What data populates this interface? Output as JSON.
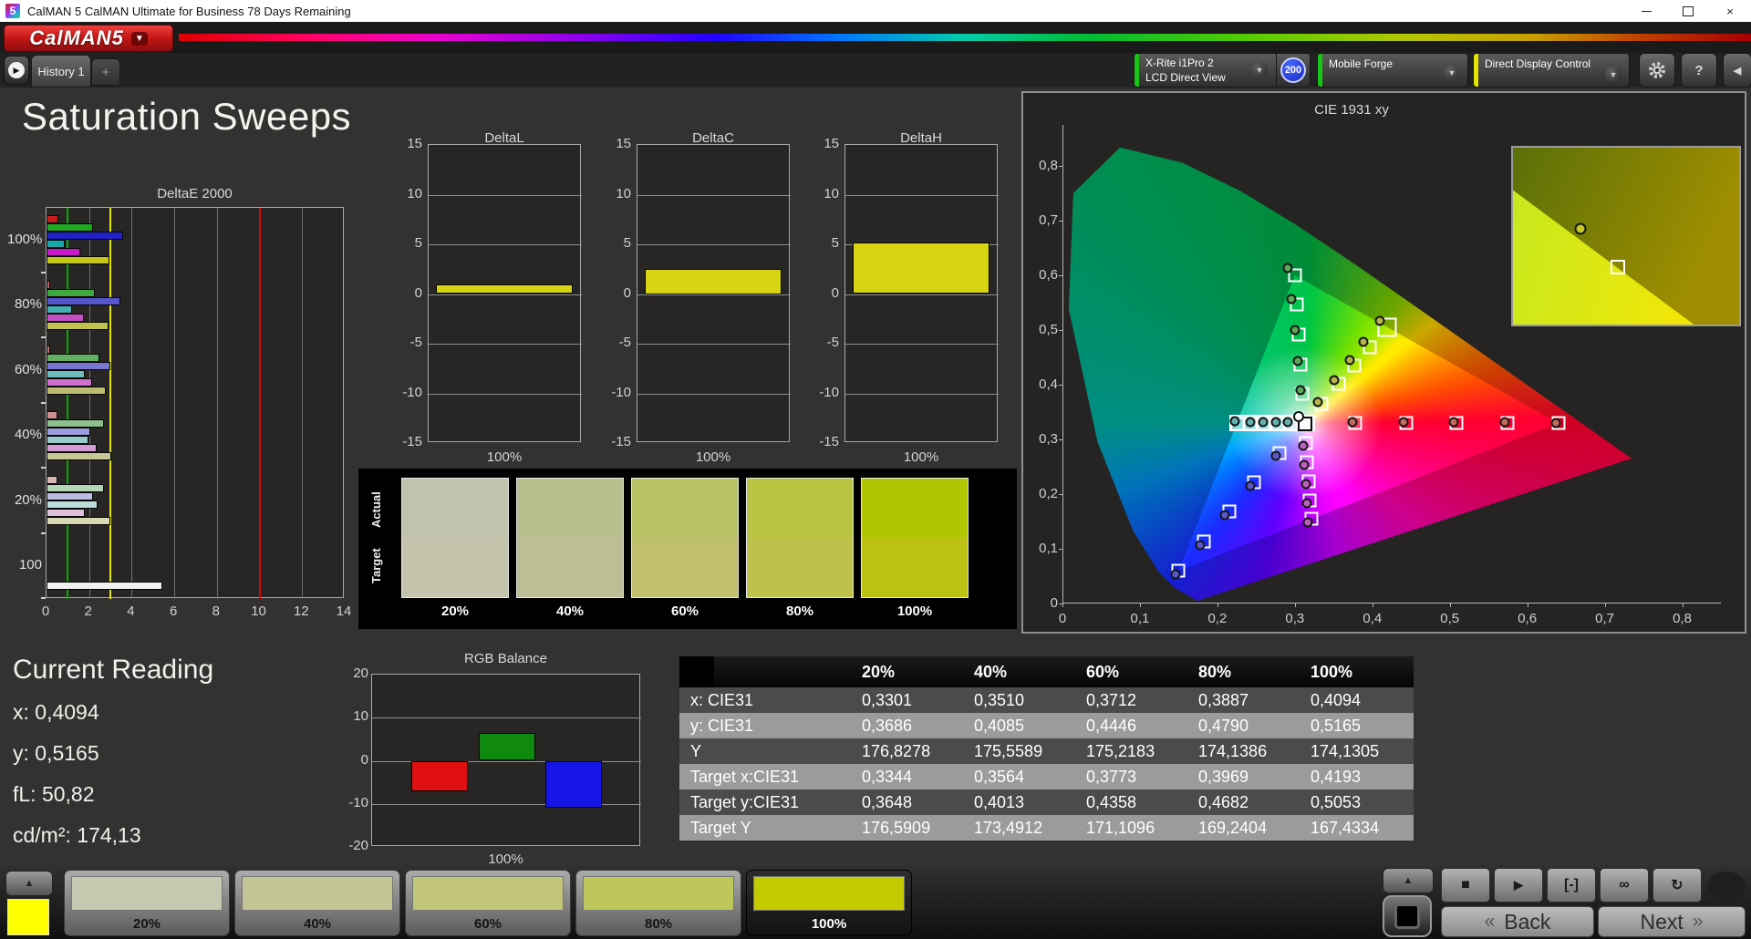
{
  "window": {
    "icon_text": "5",
    "title": "CalMAN 5 CalMAN Ultimate for Business 78 Days Remaining"
  },
  "logo": {
    "brand": "CalMAN",
    "version": "5"
  },
  "tab_bar": {
    "tabs": [
      {
        "label": "History 1",
        "active": true
      },
      {
        "label": "+",
        "active": false
      }
    ]
  },
  "toolbar": {
    "meter": {
      "line1": "X-Rite i1Pro 2",
      "line2": "LCD Direct View",
      "badge": "200",
      "accent": "#17c517"
    },
    "source": {
      "label": "Mobile Forge",
      "accent": "#17c517"
    },
    "display_control": {
      "label": "Direct Display Control",
      "accent": "#e3e300"
    },
    "help_label": "?"
  },
  "page_title": "Saturation Sweeps",
  "current_reading": {
    "title": "Current Reading",
    "items": [
      {
        "label": "x:",
        "value": "0,4094"
      },
      {
        "label": "y:",
        "value": "0,5165"
      },
      {
        "label": "fL:",
        "value": "50,82"
      },
      {
        "label": "cd/m²:",
        "value": "174,13"
      }
    ]
  },
  "table": {
    "columns": [
      "20%",
      "40%",
      "60%",
      "80%",
      "100%"
    ],
    "rows": [
      {
        "label": "x: CIE31",
        "values": [
          "0,3301",
          "0,3510",
          "0,3712",
          "0,3887",
          "0,4094"
        ]
      },
      {
        "label": "y: CIE31",
        "values": [
          "0,3686",
          "0,4085",
          "0,4446",
          "0,4790",
          "0,5165"
        ]
      },
      {
        "label": "Y",
        "values": [
          "176,8278",
          "175,5589",
          "175,2183",
          "174,1386",
          "174,1305"
        ]
      },
      {
        "label": "Target x:CIE31",
        "values": [
          "0,3344",
          "0,3564",
          "0,3773",
          "0,3969",
          "0,4193"
        ]
      },
      {
        "label": "Target y:CIE31",
        "values": [
          "0,3648",
          "0,4013",
          "0,4358",
          "0,4682",
          "0,5053"
        ]
      },
      {
        "label": "Target Y",
        "values": [
          "176,5909",
          "173,4912",
          "171,1096",
          "169,2404",
          "167,4334"
        ]
      }
    ]
  },
  "patterns": {
    "selected_index": 4,
    "current_color": "#ffff00",
    "items": [
      {
        "label": "20%",
        "color": "#c6c8af"
      },
      {
        "label": "40%",
        "color": "#c3c595"
      },
      {
        "label": "60%",
        "color": "#c1c679"
      },
      {
        "label": "80%",
        "color": "#bfc65b"
      },
      {
        "label": "100%",
        "color": "#c4cc00"
      }
    ]
  },
  "transport": {
    "buttons": [
      {
        "name": "stop",
        "glyph": "■"
      },
      {
        "name": "play",
        "glyph": "▶"
      },
      {
        "name": "range",
        "glyph": "[-]"
      },
      {
        "name": "continuous",
        "glyph": "∞"
      },
      {
        "name": "loop",
        "glyph": "↻"
      }
    ]
  },
  "nav": {
    "back": "Back",
    "next": "Next",
    "back_chevrons": "«",
    "next_chevrons": "»"
  },
  "chart_data": [
    {
      "id": "deltae2000",
      "type": "bar",
      "orientation": "horizontal",
      "title": "DeltaE 2000",
      "xlim": [
        0,
        14
      ],
      "xticks": [
        0,
        2,
        4,
        6,
        8,
        10,
        12,
        14
      ],
      "reference_lines": [
        {
          "value": 1,
          "color": "#00b000"
        },
        {
          "value": 3,
          "color": "#e3e300"
        },
        {
          "value": 10,
          "color": "#e00000"
        }
      ],
      "groups": [
        {
          "label": "100%",
          "bars": [
            {
              "name": "red",
              "color": "#c81c1c",
              "value": 0.55
            },
            {
              "name": "green",
              "color": "#1fa81f",
              "value": 2.2
            },
            {
              "name": "blue",
              "color": "#2121c8",
              "value": 3.6
            },
            {
              "name": "cyan",
              "color": "#16aaaa",
              "value": 0.85
            },
            {
              "name": "magenta",
              "color": "#c818c8",
              "value": 1.6
            },
            {
              "name": "yellow",
              "color": "#c6c616",
              "value": 2.95
            }
          ]
        },
        {
          "label": "80%",
          "bars": [
            {
              "name": "red",
              "color": "#c46060",
              "value": 0.15
            },
            {
              "name": "green",
              "color": "#3da83d",
              "value": 2.25
            },
            {
              "name": "blue",
              "color": "#5555cd",
              "value": 3.45
            },
            {
              "name": "cyan",
              "color": "#42b0b0",
              "value": 1.2
            },
            {
              "name": "magenta",
              "color": "#c44fc4",
              "value": 1.75
            },
            {
              "name": "yellow",
              "color": "#c2c24e",
              "value": 2.9
            }
          ]
        },
        {
          "label": "60%",
          "bars": [
            {
              "name": "red",
              "color": "#c87878",
              "value": 0.15
            },
            {
              "name": "green",
              "color": "#62b062",
              "value": 2.5
            },
            {
              "name": "blue",
              "color": "#7878d2",
              "value": 3.0
            },
            {
              "name": "cyan",
              "color": "#70bcbc",
              "value": 1.8
            },
            {
              "name": "magenta",
              "color": "#cc70cc",
              "value": 2.15
            },
            {
              "name": "yellow",
              "color": "#bcbc70",
              "value": 2.8
            }
          ]
        },
        {
          "label": "40%",
          "bars": [
            {
              "name": "red",
              "color": "#d09090",
              "value": 0.5
            },
            {
              "name": "green",
              "color": "#8cc08c",
              "value": 2.7
            },
            {
              "name": "blue",
              "color": "#9c9cdc",
              "value": 2.05
            },
            {
              "name": "cyan",
              "color": "#96cccc",
              "value": 1.95
            },
            {
              "name": "magenta",
              "color": "#d49cd4",
              "value": 2.35
            },
            {
              "name": "yellow",
              "color": "#c8c896",
              "value": 3.05
            }
          ]
        },
        {
          "label": "20%",
          "bars": [
            {
              "name": "red",
              "color": "#dcb4b4",
              "value": 0.5
            },
            {
              "name": "green",
              "color": "#b4d6b4",
              "value": 2.7
            },
            {
              "name": "blue",
              "color": "#bcbce4",
              "value": 2.2
            },
            {
              "name": "cyan",
              "color": "#bcdcdc",
              "value": 2.4
            },
            {
              "name": "magenta",
              "color": "#dcc0dc",
              "value": 1.8
            },
            {
              "name": "yellow",
              "color": "#d8d8b4",
              "value": 3.0
            }
          ]
        },
        {
          "label": "100",
          "bars": [
            {
              "name": "white",
              "color": "#f0f0f0",
              "value": 5.45
            }
          ]
        }
      ]
    },
    {
      "id": "delta_l",
      "type": "bar",
      "title": "DeltaL",
      "ylim": [
        -15,
        15
      ],
      "yticks": [
        15,
        10,
        5,
        0,
        -5,
        -10,
        -15
      ],
      "categories": [
        "100%"
      ],
      "values": [
        1.0
      ],
      "bar_color": "#d8d414"
    },
    {
      "id": "delta_c",
      "type": "bar",
      "title": "DeltaC",
      "ylim": [
        -15,
        15
      ],
      "yticks": [
        15,
        10,
        5,
        0,
        -5,
        -10,
        -15
      ],
      "categories": [
        "100%"
      ],
      "values": [
        2.5
      ],
      "bar_color": "#d8d414"
    },
    {
      "id": "delta_h",
      "type": "bar",
      "title": "DeltaH",
      "ylim": [
        -15,
        15
      ],
      "yticks": [
        15,
        10,
        5,
        0,
        -5,
        -10,
        -15
      ],
      "categories": [
        "100%"
      ],
      "values": [
        5.2
      ],
      "bar_color": "#d8d414"
    },
    {
      "id": "rgb_balance",
      "type": "bar",
      "title": "RGB Balance",
      "ylim": [
        -20,
        20
      ],
      "yticks": [
        20,
        10,
        0,
        -10,
        -20
      ],
      "categories": [
        "100%"
      ],
      "series": [
        {
          "name": "red",
          "color": "#e01010",
          "value": -7
        },
        {
          "name": "green",
          "color": "#0f8a0f",
          "value": 6.5
        },
        {
          "name": "blue",
          "color": "#1515e8",
          "value": -11
        }
      ]
    },
    {
      "id": "cie1931",
      "type": "scatter",
      "title": "CIE 1931 xy",
      "xlim": [
        0,
        0.85
      ],
      "ylim": [
        0,
        0.875
      ],
      "xtick_labels": [
        "0",
        "0,1",
        "0,2",
        "0,3",
        "0,4",
        "0,5",
        "0,6",
        "0,7",
        "0,8"
      ],
      "ytick_labels": [
        "0",
        "0,1",
        "0,2",
        "0,3",
        "0,4",
        "0,5",
        "0,6",
        "0,7",
        "0,8"
      ],
      "white_point": {
        "x": 0.3127,
        "y": 0.329
      },
      "gamut_triangle": [
        [
          0.64,
          0.33
        ],
        [
          0.3,
          0.6
        ],
        [
          0.15,
          0.06
        ]
      ],
      "sweeps": [
        {
          "name": "red",
          "marker_color": "#c46a5a",
          "measured": [
            [
              0.374,
              0.331
            ],
            [
              0.44,
              0.332
            ],
            [
              0.505,
              0.332
            ],
            [
              0.571,
              0.331
            ],
            [
              0.637,
              0.33
            ]
          ],
          "targets": [
            [
              0.378,
              0.3292
            ],
            [
              0.444,
              0.3294
            ],
            [
              0.509,
              0.3296
            ],
            [
              0.575,
              0.3298
            ],
            [
              0.64,
              0.33
            ]
          ]
        },
        {
          "name": "yellow",
          "marker_color": "#b4b448",
          "measured": [
            [
              0.3301,
              0.3686
            ],
            [
              0.351,
              0.4085
            ],
            [
              0.3712,
              0.4446
            ],
            [
              0.3887,
              0.479
            ],
            [
              0.4094,
              0.5165
            ]
          ],
          "targets": [
            [
              0.3344,
              0.3648
            ],
            [
              0.3564,
              0.4013
            ],
            [
              0.3773,
              0.4358
            ],
            [
              0.3969,
              0.4682
            ],
            [
              0.4193,
              0.5053
            ]
          ]
        },
        {
          "name": "green",
          "marker_color": "#5aaa5a",
          "measured": [
            [
              0.307,
              0.39
            ],
            [
              0.304,
              0.444
            ],
            [
              0.3,
              0.5
            ],
            [
              0.296,
              0.556
            ],
            [
              0.291,
              0.614
            ]
          ],
          "targets": [
            [
              0.31,
              0.383
            ],
            [
              0.3075,
              0.437
            ],
            [
              0.305,
              0.492
            ],
            [
              0.3025,
              0.546
            ],
            [
              0.3,
              0.6
            ]
          ]
        },
        {
          "name": "cyan",
          "marker_color": "#62b2b2",
          "measured": [
            [
              0.291,
              0.331
            ],
            [
              0.2755,
              0.331
            ],
            [
              0.259,
              0.332
            ],
            [
              0.242,
              0.332
            ],
            [
              0.222,
              0.333
            ]
          ],
          "targets": [
            [
              0.295,
              0.329
            ],
            [
              0.278,
              0.329
            ],
            [
              0.2605,
              0.329
            ],
            [
              0.243,
              0.329
            ],
            [
              0.2255,
              0.329
            ]
          ]
        },
        {
          "name": "blue",
          "marker_color": "#5858c8",
          "measured": [
            [
              0.276,
              0.27
            ],
            [
              0.243,
              0.215
            ],
            [
              0.21,
              0.161
            ],
            [
              0.178,
              0.107
            ],
            [
              0.146,
              0.054
            ]
          ],
          "targets": [
            [
              0.28,
              0.2752
            ],
            [
              0.2475,
              0.2214
            ],
            [
              0.215,
              0.1676
            ],
            [
              0.1825,
              0.1138
            ],
            [
              0.15,
              0.06
            ]
          ]
        },
        {
          "name": "magenta",
          "marker_color": "#bb60bb",
          "measured": [
            [
              0.311,
              0.289
            ],
            [
              0.3125,
              0.254
            ],
            [
              0.314,
              0.219
            ],
            [
              0.3155,
              0.184
            ],
            [
              0.317,
              0.149
            ]
          ],
          "targets": [
            [
              0.3143,
              0.294
            ],
            [
              0.316,
              0.259
            ],
            [
              0.3176,
              0.224
            ],
            [
              0.3193,
              0.189
            ],
            [
              0.3209,
              0.1542
            ]
          ]
        }
      ],
      "current": {
        "sweep": "yellow",
        "index": 4
      },
      "highlight_rect": {
        "x0": 0.215,
        "y0": 0.315,
        "x1": 0.326,
        "y1": 0.345
      },
      "inset": {
        "circle": {
          "fx": 0.3,
          "fy": 0.46
        },
        "square": {
          "fx": 0.465,
          "fy": 0.675
        }
      }
    },
    {
      "id": "saturation_swatches",
      "type": "table",
      "row_labels": [
        "Actual",
        "Target"
      ],
      "columns": [
        "20%",
        "40%",
        "60%",
        "80%",
        "100%"
      ],
      "actual_colors": [
        "#c1c4ad",
        "#b9be8f",
        "#b8c264",
        "#b7c341",
        "#b2c503"
      ],
      "target_colors": [
        "#c4c4ac",
        "#bdbe95",
        "#bfbf6e",
        "#bec14c",
        "#bcc214"
      ]
    }
  ]
}
